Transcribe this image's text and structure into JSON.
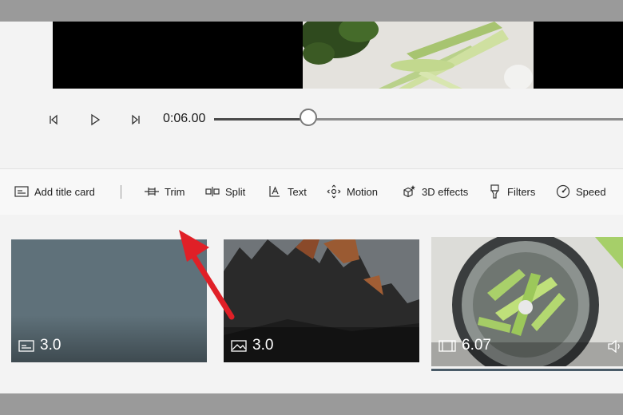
{
  "playback": {
    "time": "0:06.00",
    "progress_fraction": 0.23
  },
  "toolbar": {
    "add_title_card": "Add title card",
    "trim": "Trim",
    "split": "Split",
    "text": "Text",
    "motion": "Motion",
    "effects_3d": "3D effects",
    "filters": "Filters",
    "speed": "Speed"
  },
  "clips": [
    {
      "type": "title-card",
      "duration": "3.0",
      "icon": "image-icon"
    },
    {
      "type": "photo",
      "duration": "3.0",
      "icon": "image-icon"
    },
    {
      "type": "video",
      "duration": "6.07",
      "icon": "film-icon",
      "audio_icon": "volume-icon"
    }
  ],
  "colors": {
    "annotation_arrow": "#e02027",
    "title_card_bg": "#5f717a"
  }
}
